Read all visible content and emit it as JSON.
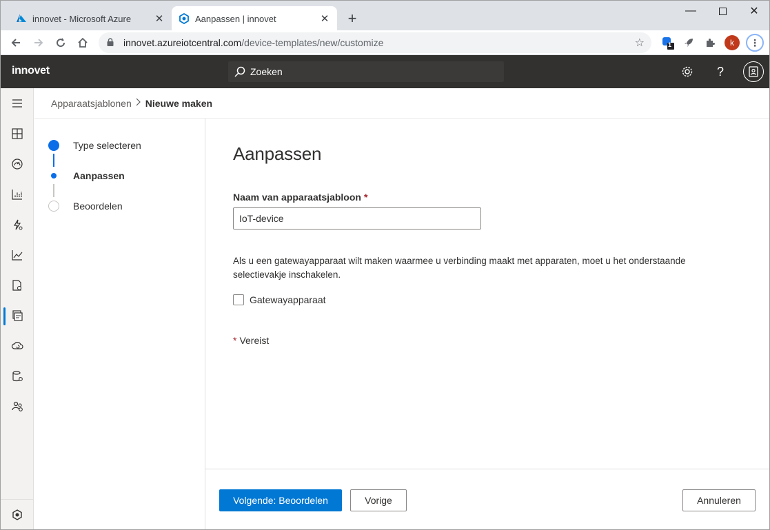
{
  "browser": {
    "tabs": [
      {
        "title": "innovet - Microsoft Azure",
        "favicon": "azure-icon",
        "active": false
      },
      {
        "title": "Aanpassen | innovet",
        "favicon": "iot-central-icon",
        "active": true
      }
    ],
    "address": {
      "host": "innovet.azureiotcentral.com",
      "path": "/device-templates/new/customize"
    },
    "extensions": [
      {
        "icon": "extension-badge-icon",
        "badge": "1"
      },
      {
        "icon": "rocket-icon"
      },
      {
        "icon": "puzzle-icon"
      }
    ],
    "profile_initial": "k"
  },
  "app": {
    "name": "innovet",
    "search_placeholder": "Zoeken"
  },
  "nav": {
    "items": [
      {
        "name": "menu",
        "icon": "hamburger-icon"
      },
      {
        "name": "dashboards",
        "icon": "dashboard-icon"
      },
      {
        "name": "devices",
        "icon": "devices-icon"
      },
      {
        "name": "device-groups",
        "icon": "device-groups-icon"
      },
      {
        "name": "rules",
        "icon": "rules-icon"
      },
      {
        "name": "analytics",
        "icon": "analytics-icon"
      },
      {
        "name": "jobs",
        "icon": "jobs-icon"
      },
      {
        "name": "device-templates",
        "icon": "device-templates-icon",
        "active": true
      },
      {
        "name": "data-export",
        "icon": "data-export-icon"
      },
      {
        "name": "administration",
        "icon": "administration-icon"
      },
      {
        "name": "permissions",
        "icon": "permissions-icon"
      },
      {
        "name": "iot-central-home",
        "icon": "iot-central-icon"
      }
    ]
  },
  "breadcrumb": {
    "parent": "Apparaatsjablonen",
    "current": "Nieuwe maken"
  },
  "steps": [
    {
      "label": "Type selecteren",
      "state": "completed"
    },
    {
      "label": "Aanpassen",
      "state": "current"
    },
    {
      "label": "Beoordelen",
      "state": "pending"
    }
  ],
  "form": {
    "title": "Aanpassen",
    "name_label": "Naam van apparaatsjabloon",
    "required_mark": "*",
    "name_value": "IoT-device",
    "help_text": "Als u een gatewayapparaat wilt maken waarmee u verbinding maakt met apparaten, moet u het onderstaande selectievakje inschakelen.",
    "gateway_label": "Gatewayapparaat",
    "gateway_checked": false,
    "required_note": "Vereist"
  },
  "footer": {
    "next_label": "Volgende: Beoordelen",
    "previous_label": "Vorige",
    "cancel_label": "Annuleren"
  },
  "colors": {
    "accent": "#0078d4",
    "appbar": "#323130",
    "required": "#a4262c"
  }
}
